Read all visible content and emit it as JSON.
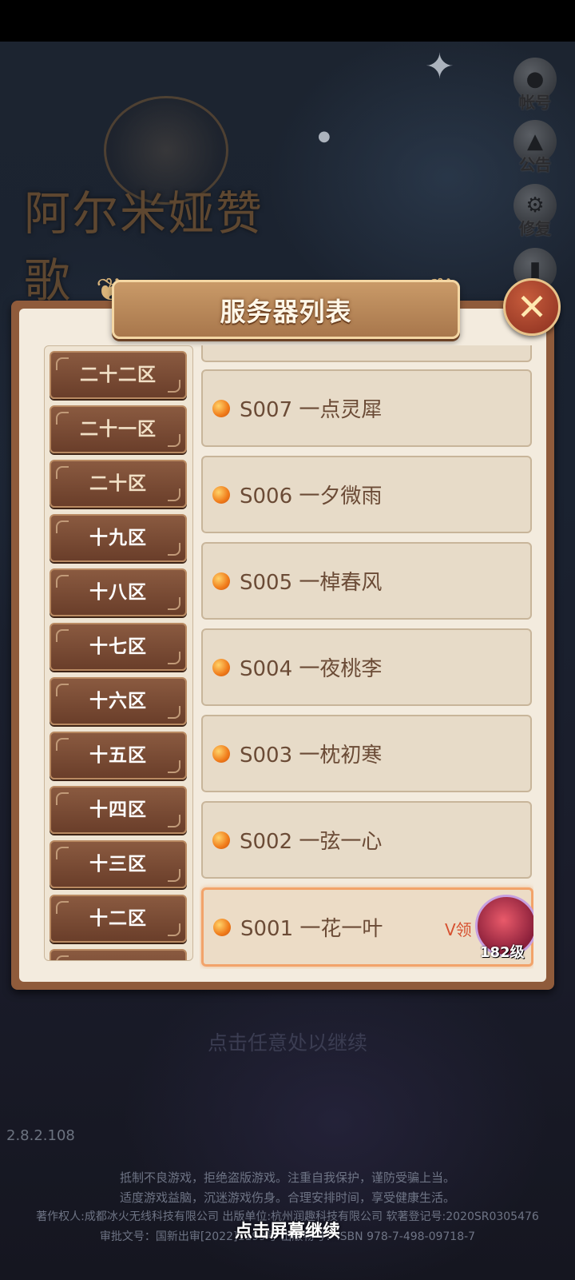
{
  "game_title": "阿尔米娅赞歌",
  "side_menu": [
    {
      "label": "帐号",
      "icon": "user-icon"
    },
    {
      "label": "公告",
      "icon": "megaphone-icon"
    },
    {
      "label": "修复",
      "icon": "gear-icon"
    },
    {
      "label": "",
      "icon": "document-icon"
    }
  ],
  "dialog": {
    "title": "服务器列表",
    "close_icon": "close-icon"
  },
  "zones": [
    "二十二区",
    "二十一区",
    "二十区",
    "十九区",
    "十八区",
    "十七区",
    "十六区",
    "十五区",
    "十四区",
    "十三区",
    "十二区"
  ],
  "servers": [
    {
      "name": "S007 一点灵犀"
    },
    {
      "name": "S006 一夕微雨"
    },
    {
      "name": "S005 一棹春风"
    },
    {
      "name": "S004 一夜桃李"
    },
    {
      "name": "S003 一枕初寒"
    },
    {
      "name": "S002 一弦一心"
    },
    {
      "name": "S001 一花一叶",
      "badge": "V领",
      "level": "182级",
      "selected": true
    }
  ],
  "continue_hint": "点击任意处以继续",
  "version": "2.8.2.108",
  "footer": {
    "line1": "抵制不良游戏，拒绝盗版游戏。注重自我保护，谨防受骗上当。",
    "line2": "适度游戏益脑，沉迷游戏伤身。合理安排时间，享受健康生活。",
    "line3": "著作权人:成都冰火无线科技有限公司 出版单位:杭州润趣科技有限公司 软著登记号:2020SR0305476",
    "line4": "审批文号：国新出审[2022]1199号 出版物号：ISBN 978-7-498-09718-7"
  },
  "tap_continue": "点击屏幕继续",
  "colors": {
    "panel_border": "#8f5b3b",
    "panel_bg": "#f3ebde",
    "zone_button": "#7a4c34",
    "status_dot": "#f07b1a",
    "selected_border": "#f2a36a"
  }
}
